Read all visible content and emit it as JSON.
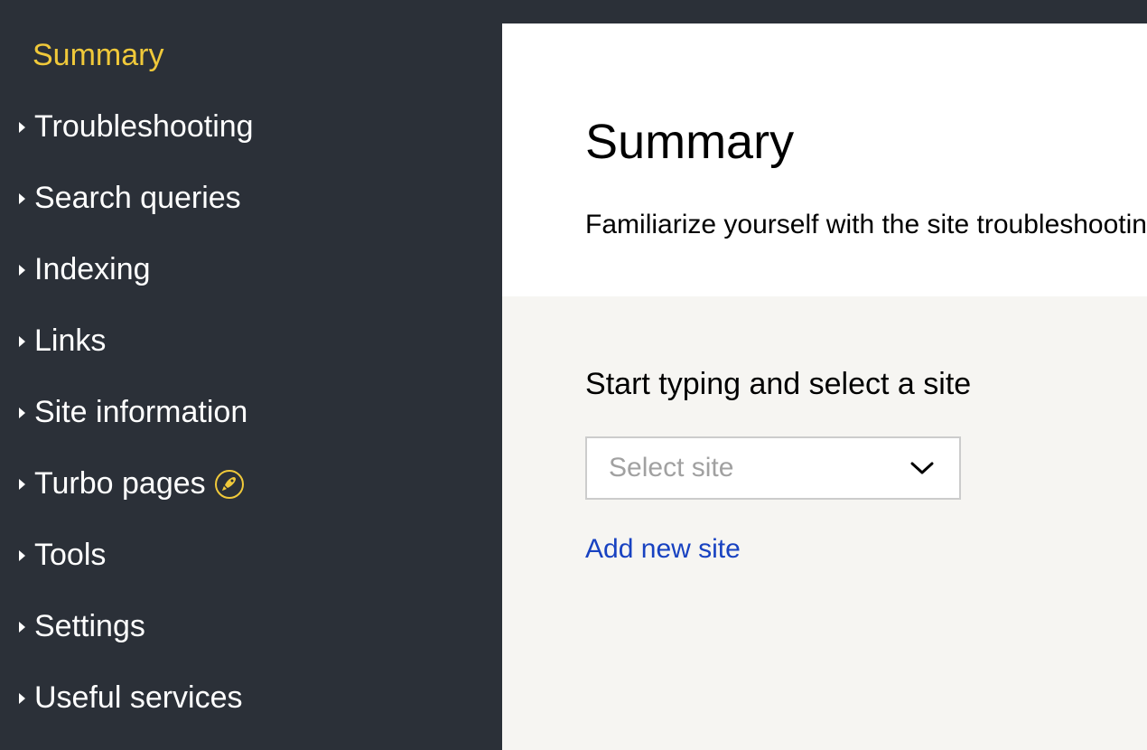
{
  "sidebar": {
    "items": [
      {
        "label": "Summary",
        "active": true,
        "has_caret": false,
        "has_rocket": false
      },
      {
        "label": "Troubleshooting",
        "active": false,
        "has_caret": true,
        "has_rocket": false
      },
      {
        "label": "Search queries",
        "active": false,
        "has_caret": true,
        "has_rocket": false
      },
      {
        "label": "Indexing",
        "active": false,
        "has_caret": true,
        "has_rocket": false
      },
      {
        "label": "Links",
        "active": false,
        "has_caret": true,
        "has_rocket": false
      },
      {
        "label": "Site information",
        "active": false,
        "has_caret": true,
        "has_rocket": false
      },
      {
        "label": "Turbo pages",
        "active": false,
        "has_caret": true,
        "has_rocket": true
      },
      {
        "label": "Tools",
        "active": false,
        "has_caret": true,
        "has_rocket": false
      },
      {
        "label": "Settings",
        "active": false,
        "has_caret": true,
        "has_rocket": false
      },
      {
        "label": "Useful services",
        "active": false,
        "has_caret": true,
        "has_rocket": false
      }
    ]
  },
  "main": {
    "title": "Summary",
    "subtitle": "Familiarize yourself with the site troubleshootin",
    "select_prompt": "Start typing and select a site",
    "select_placeholder": "Select site",
    "add_link_label": "Add new site"
  },
  "colors": {
    "sidebar_bg": "#2b3038",
    "active_text": "#f0c93a",
    "link": "#1842c1",
    "body_bg": "#f6f5f2"
  }
}
